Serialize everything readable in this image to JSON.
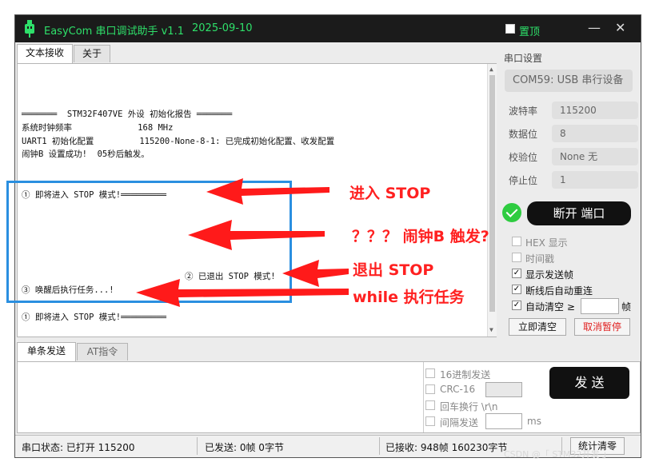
{
  "titlebar": {
    "app": "EasyCom 串口调试助手 v1.1",
    "date": "2025-09-10",
    "pin_label": "置顶",
    "minimize": "—",
    "close": "✕"
  },
  "tabs": {
    "recv": "文本接收",
    "about": "关于",
    "single_send": "单条发送",
    "at_cmd": "AT指令"
  },
  "recv_lines": {
    "l1": "═══════  STM32F407VE 外设 初始化报告 ═══════",
    "l2": "系统时钟频率             168 MHz",
    "l3": "UART1 初始化配置         115200-None-8-1: 已完成初始化配置、收发配置",
    "l4": "闹钟B 设置成功!  05秒后触发。",
    "l5": "① 即将进入 STOP 模式!═════════",
    "l6": "② 已退出 STOP 模式!",
    "l7": "③ 唤醒后执行任务...!",
    "l8": "① 即将进入 STOP 模式!═════════"
  },
  "serial": {
    "title": "串口设置",
    "port": "COM59: USB 串行设备",
    "baud_label": "波特率",
    "baud": "115200",
    "data_label": "数据位",
    "data": "8",
    "parity_label": "校验位",
    "parity": "None  无",
    "stop_label": "停止位",
    "stop": "1",
    "disconnect": "断开 端口"
  },
  "options": {
    "hex": "HEX 显示",
    "timestamp": "时间戳",
    "show_send": "显示发送帧",
    "auto_reconnect": "断线后自动重连",
    "auto_clear": "自动清空 ≥",
    "frame_unit": "帧",
    "clear_now": "立即清空",
    "pause_clear": "取消暂停"
  },
  "send": {
    "hex_send": "16进制发送",
    "crc": "CRC-16",
    "crlf": "回车换行 \\r\\n",
    "interval": "间隔发送",
    "ms": "ms",
    "send_btn": "发 送"
  },
  "statusbar": {
    "port_status": "串口状态: 已打开 115200",
    "sent": "已发送: 0帧    0字节",
    "received": "已接收: 948帧   160230字节",
    "stats_clear": "统计清零"
  },
  "annotations": {
    "a1": "进入 STOP",
    "a2": "？？？  闹钟B 触发?",
    "a3": "退出 STOP",
    "a4": "while 执行任务"
  },
  "watermark": "CSDN @「 STM32开发 」",
  "colors": {
    "title_green": "#2ee06a",
    "annot_red": "#ff2020",
    "annot_blue": "#2a8fe0",
    "status_green": "#2ecc40"
  }
}
